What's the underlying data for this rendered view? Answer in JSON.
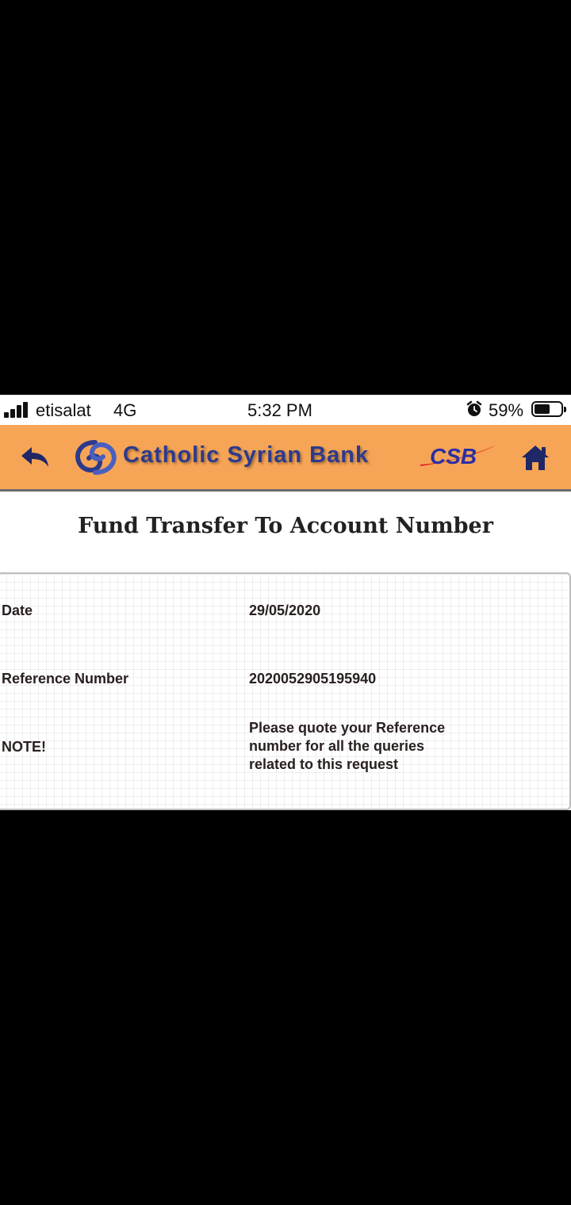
{
  "status_bar": {
    "carrier": "etisalat",
    "network": "4G",
    "time": "5:32 PM",
    "battery": "59%",
    "battery_level": 0.59,
    "icons": [
      "signal-icon",
      "alarm-icon",
      "battery-icon"
    ]
  },
  "header": {
    "bank_name": "Catholic Syrian Bank",
    "brand_mark": "CSB",
    "background_color": "#f6a556",
    "icons": [
      "back-arrow-icon",
      "bank-logo-icon",
      "home-icon"
    ]
  },
  "page": {
    "title": "Fund Transfer To Account Number"
  },
  "details": {
    "date_label": "Date",
    "date_value": "29/05/2020",
    "reference_label": "Reference Number",
    "reference_value": "2020052905195940",
    "note_label": "NOTE!",
    "note_lines": [
      "Please quote your Reference",
      "number for all the queries",
      "related to this request"
    ]
  }
}
